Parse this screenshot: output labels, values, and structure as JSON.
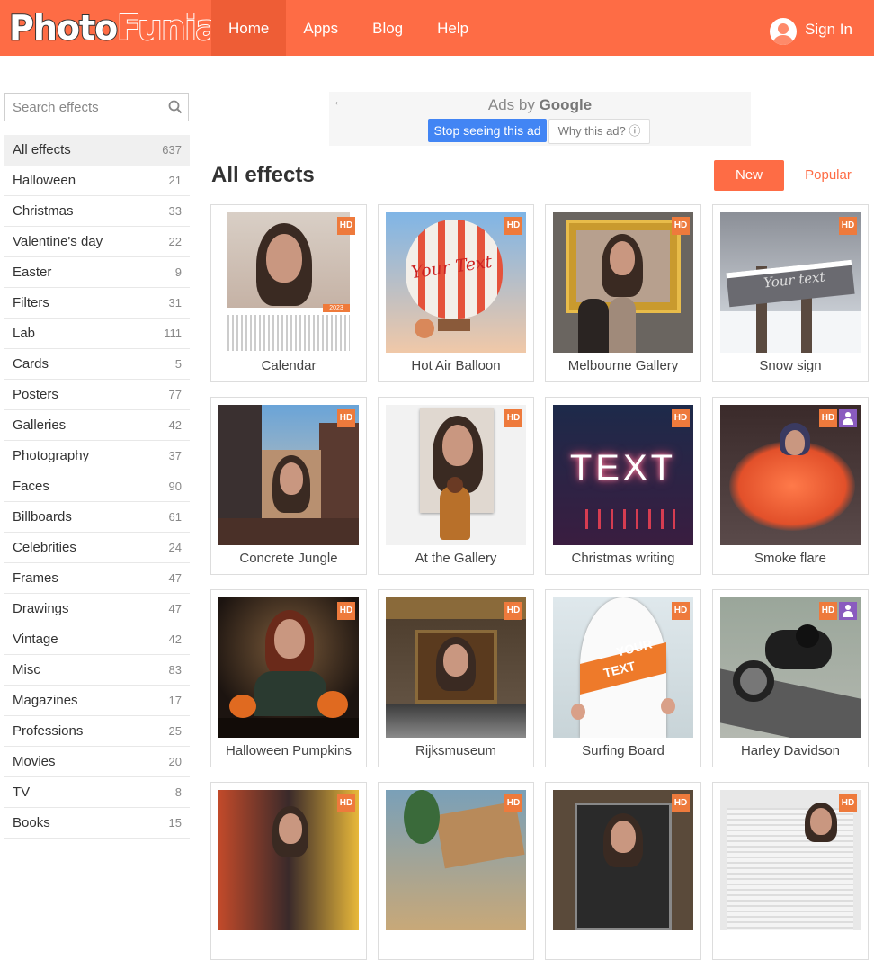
{
  "header": {
    "logo_part1": "Photo",
    "logo_part2": "Funia",
    "nav": [
      "Home",
      "Apps",
      "Blog",
      "Help"
    ],
    "active_nav": "Home",
    "signin_label": "Sign In",
    "brand_color": "#fe6c45"
  },
  "search": {
    "placeholder": "Search effects",
    "icon": "search-icon"
  },
  "categories": [
    {
      "label": "All effects",
      "count": "637"
    },
    {
      "label": "Halloween",
      "count": "21"
    },
    {
      "label": "Christmas",
      "count": "33"
    },
    {
      "label": "Valentine's day",
      "count": "22"
    },
    {
      "label": "Easter",
      "count": "9"
    },
    {
      "label": "Filters",
      "count": "31"
    },
    {
      "label": "Lab",
      "count": "111"
    },
    {
      "label": "Cards",
      "count": "5"
    },
    {
      "label": "Posters",
      "count": "77"
    },
    {
      "label": "Galleries",
      "count": "42"
    },
    {
      "label": "Photography",
      "count": "37"
    },
    {
      "label": "Faces",
      "count": "90"
    },
    {
      "label": "Billboards",
      "count": "61"
    },
    {
      "label": "Celebrities",
      "count": "24"
    },
    {
      "label": "Frames",
      "count": "47"
    },
    {
      "label": "Drawings",
      "count": "47"
    },
    {
      "label": "Vintage",
      "count": "42"
    },
    {
      "label": "Misc",
      "count": "83"
    },
    {
      "label": "Magazines",
      "count": "17"
    },
    {
      "label": "Professions",
      "count": "25"
    },
    {
      "label": "Movies",
      "count": "20"
    },
    {
      "label": "TV",
      "count": "8"
    },
    {
      "label": "Books",
      "count": "15"
    }
  ],
  "ad": {
    "back": "←",
    "title_prefix": "Ads by",
    "title_brand": "Google",
    "stop_label": "Stop seeing this ad",
    "why_label": "Why this ad? ⓘ"
  },
  "main": {
    "title": "All effects",
    "sort_new": "New",
    "sort_popular": "Popular"
  },
  "badges": {
    "hd": "HD"
  },
  "effects": [
    {
      "label": "Calendar",
      "hd": true,
      "person": false
    },
    {
      "label": "Hot Air Balloon",
      "hd": true,
      "person": false
    },
    {
      "label": "Melbourne Gallery",
      "hd": true,
      "person": false
    },
    {
      "label": "Snow sign",
      "hd": true,
      "person": false
    },
    {
      "label": "Concrete Jungle",
      "hd": true,
      "person": false
    },
    {
      "label": "At the Gallery",
      "hd": true,
      "person": false
    },
    {
      "label": "Christmas writing",
      "hd": true,
      "person": false
    },
    {
      "label": "Smoke flare",
      "hd": true,
      "person": true
    },
    {
      "label": "Halloween Pumpkins",
      "hd": true,
      "person": false
    },
    {
      "label": "Rijksmuseum",
      "hd": true,
      "person": false
    },
    {
      "label": "Surfing Board",
      "hd": true,
      "person": false
    },
    {
      "label": "Harley Davidson",
      "hd": true,
      "person": true
    },
    {
      "label": "",
      "hd": true,
      "person": false
    },
    {
      "label": "",
      "hd": true,
      "person": false
    },
    {
      "label": "",
      "hd": true,
      "person": false
    },
    {
      "label": "",
      "hd": true,
      "person": false
    }
  ],
  "thumb_text": {
    "balloon": "Your Text",
    "snow": "Your text",
    "xmas": "TEXT",
    "board_1": "YOUR",
    "board_2": "TEXT",
    "calendar_year": "2023"
  }
}
